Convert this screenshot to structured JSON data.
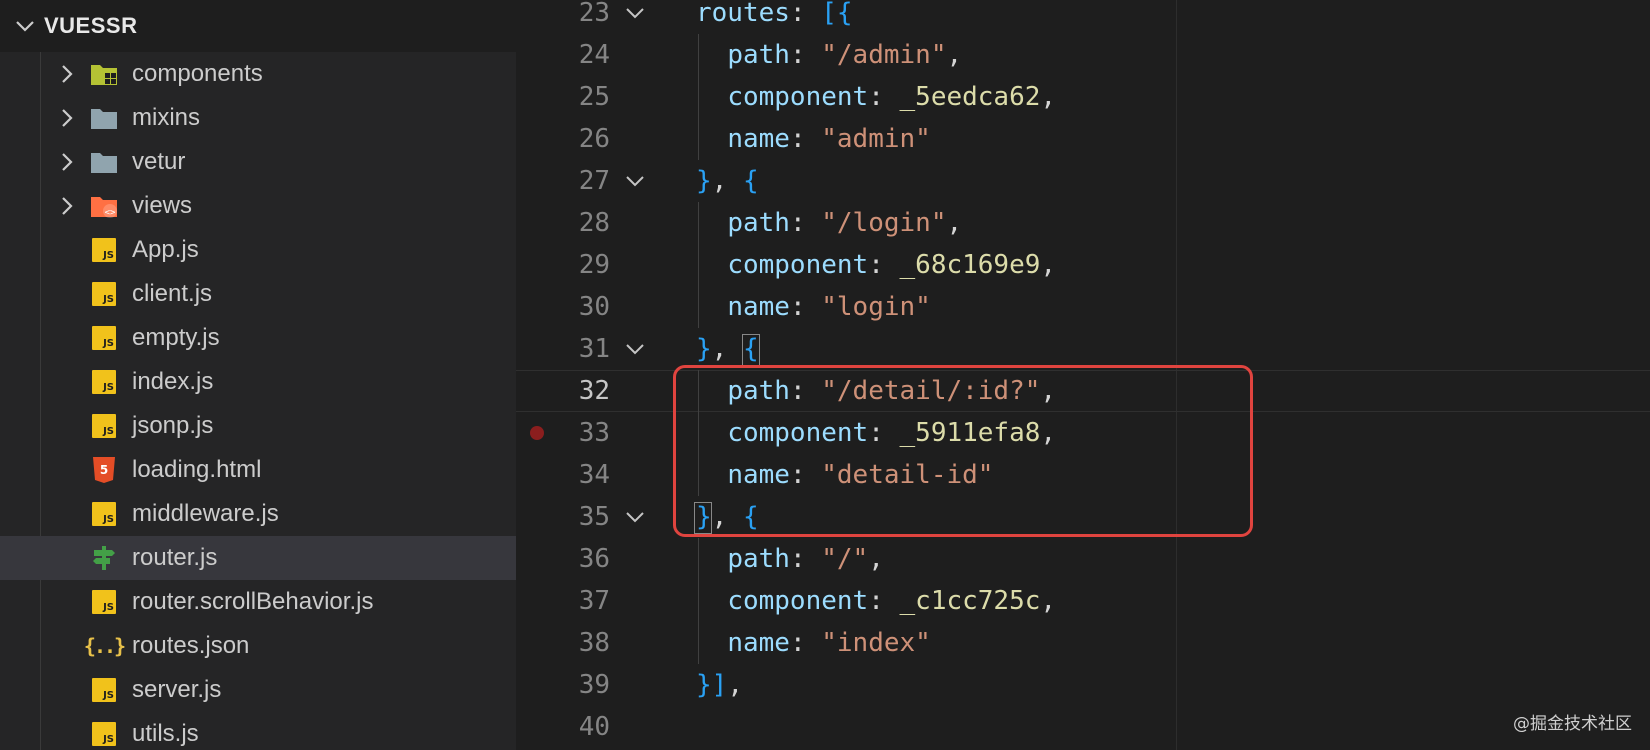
{
  "explorer": {
    "title": "VUESSR",
    "items": [
      {
        "label": "components",
        "type": "folder",
        "icon": "components-folder-icon",
        "color": "#b5c234"
      },
      {
        "label": "mixins",
        "type": "folder",
        "icon": "folder-icon",
        "color": "#90a4ae"
      },
      {
        "label": "vetur",
        "type": "folder",
        "icon": "folder-icon",
        "color": "#90a4ae"
      },
      {
        "label": "views",
        "type": "folder",
        "icon": "views-folder-icon",
        "color": "#ff7043"
      },
      {
        "label": "App.js",
        "type": "file",
        "icon": "js-file-icon"
      },
      {
        "label": "client.js",
        "type": "file",
        "icon": "js-file-icon"
      },
      {
        "label": "empty.js",
        "type": "file",
        "icon": "js-file-icon"
      },
      {
        "label": "index.js",
        "type": "file",
        "icon": "js-file-icon"
      },
      {
        "label": "jsonp.js",
        "type": "file",
        "icon": "js-file-icon"
      },
      {
        "label": "loading.html",
        "type": "file",
        "icon": "html5-file-icon"
      },
      {
        "label": "middleware.js",
        "type": "file",
        "icon": "js-file-icon"
      },
      {
        "label": "router.js",
        "type": "file",
        "icon": "router-file-icon",
        "selected": true
      },
      {
        "label": "router.scrollBehavior.js",
        "type": "file",
        "icon": "js-file-icon"
      },
      {
        "label": "routes.json",
        "type": "file",
        "icon": "json-file-icon"
      },
      {
        "label": "server.js",
        "type": "file",
        "icon": "js-file-icon"
      },
      {
        "label": "utils.js",
        "type": "file",
        "icon": "js-file-icon"
      }
    ],
    "js_badge_text": "JS",
    "json_badge_text": "{..}"
  },
  "editor": {
    "current_line": 32,
    "breakpoint_line": 33,
    "highlighted_lines": [
      32,
      33,
      34
    ],
    "lines": [
      {
        "num": "23",
        "fold": true,
        "code": "routes: [{"
      },
      {
        "num": "24",
        "fold": false,
        "code": "  path: \"/admin\","
      },
      {
        "num": "25",
        "fold": false,
        "code": "  component: _5eedca62,"
      },
      {
        "num": "26",
        "fold": false,
        "code": "  name: \"admin\""
      },
      {
        "num": "27",
        "fold": true,
        "code": "}, {"
      },
      {
        "num": "28",
        "fold": false,
        "code": "  path: \"/login\","
      },
      {
        "num": "29",
        "fold": false,
        "code": "  component: _68c169e9,"
      },
      {
        "num": "30",
        "fold": false,
        "code": "  name: \"login\""
      },
      {
        "num": "31",
        "fold": true,
        "code": "}, {"
      },
      {
        "num": "32",
        "fold": false,
        "code": "  path: \"/detail/:id?\","
      },
      {
        "num": "33",
        "fold": false,
        "code": "  component: _5911efa8,"
      },
      {
        "num": "34",
        "fold": false,
        "code": "  name: \"detail-id\""
      },
      {
        "num": "35",
        "fold": true,
        "code": "}, {"
      },
      {
        "num": "36",
        "fold": false,
        "code": "  path: \"/\","
      },
      {
        "num": "37",
        "fold": false,
        "code": "  component: _c1cc725c,"
      },
      {
        "num": "38",
        "fold": false,
        "code": "  name: \"index\""
      },
      {
        "num": "39",
        "fold": false,
        "code": "}],"
      },
      {
        "num": "40",
        "fold": false,
        "code": ""
      }
    ]
  },
  "colors": {
    "property": "#9cdcfe",
    "string": "#ce9178",
    "identifier": "#dcdcaa",
    "bracket": "#2aa1f4",
    "highlight_box": "#e0443f"
  },
  "watermark": "@掘金技术社区"
}
